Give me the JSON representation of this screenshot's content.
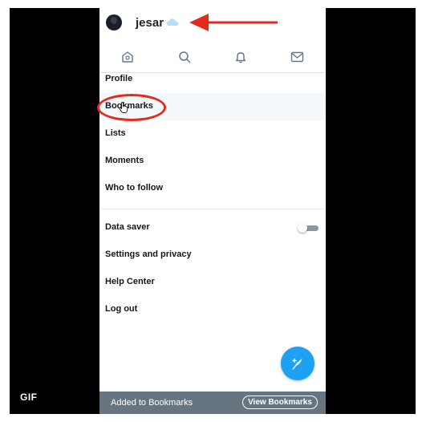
{
  "header": {
    "username": "jesar"
  },
  "nav": [
    {
      "icon": "home-icon"
    },
    {
      "icon": "search-icon"
    },
    {
      "icon": "bell-icon"
    },
    {
      "icon": "mail-icon"
    }
  ],
  "menu": {
    "profile": "Profile",
    "bookmarks": "Bookmarks",
    "lists": "Lists",
    "moments": "Moments",
    "who_to_follow": "Who to follow",
    "data_saver": "Data saver",
    "settings": "Settings and privacy",
    "help": "Help Center",
    "logout": "Log out"
  },
  "toggle": {
    "data_saver_on": false
  },
  "toast": {
    "message": "Added to Bookmarks",
    "action": "View Bookmarks"
  },
  "badge": "GIF",
  "colors": {
    "accent": "#1da1f2",
    "annotation": "#e42a1c",
    "toast_bg": "#66757f"
  }
}
